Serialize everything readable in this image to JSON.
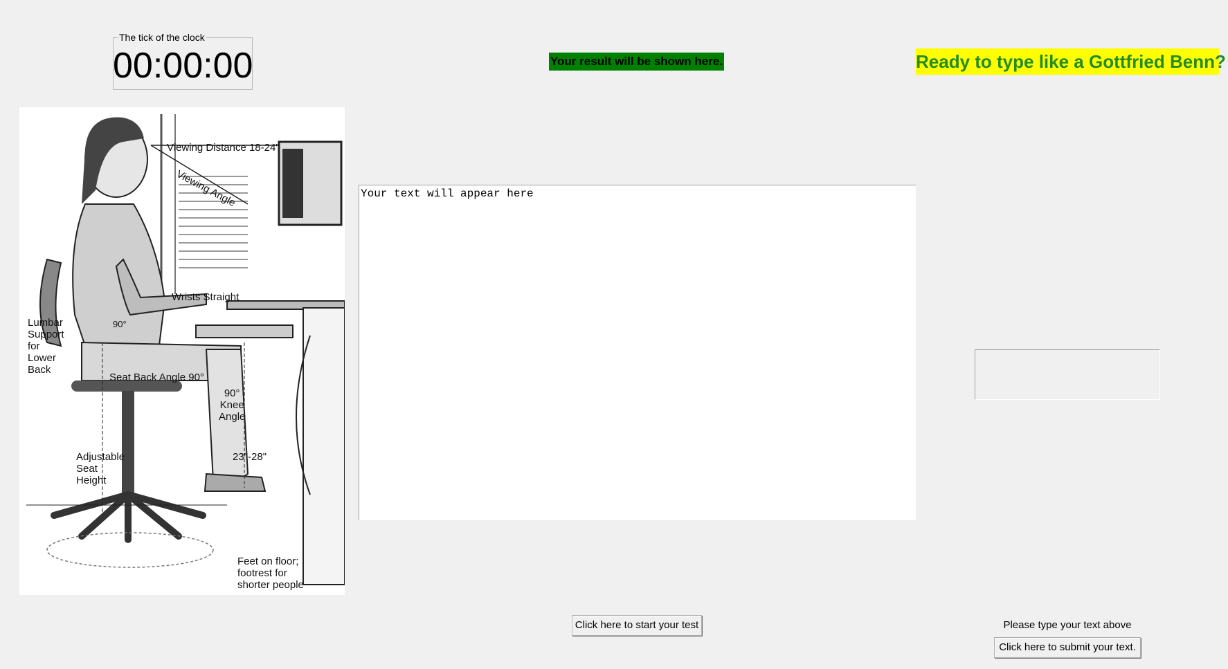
{
  "clock": {
    "legend": "The tick of the clock",
    "time": "00:00:00"
  },
  "result": {
    "message": "Your result will be shown here."
  },
  "slogan": {
    "text": "Ready to type like a Gottfried Benn?"
  },
  "picture": {
    "labels": {
      "viewing_distance": "Viewing Distance 18-24\"",
      "viewing_angle": "Viewing Angle",
      "wrists": "Wrists Straight",
      "elbow_angle": "90°",
      "lumbar": [
        "Lumbar",
        "Support",
        "for",
        "Lower",
        "Back"
      ],
      "seat_back": "Seat Back Angle 90°",
      "knee": [
        "90°",
        "Knee",
        "Angle"
      ],
      "height_range": "23\"-28\"",
      "seat_height": [
        "Adjustable",
        "Seat",
        "Height"
      ],
      "feet": [
        "Feet on floor;",
        "footrest for",
        "shorter people"
      ]
    }
  },
  "editor": {
    "placeholder": "Your text will appear here"
  },
  "controls": {
    "start_label": "Click here to start your test",
    "hint": "Please type your text above",
    "submit_label": "Click here to submit your text."
  },
  "colors": {
    "background": "#f0f0f0",
    "result_bg": "#008000",
    "slogan_bg": "#ffff00",
    "slogan_fg": "#228b22"
  }
}
